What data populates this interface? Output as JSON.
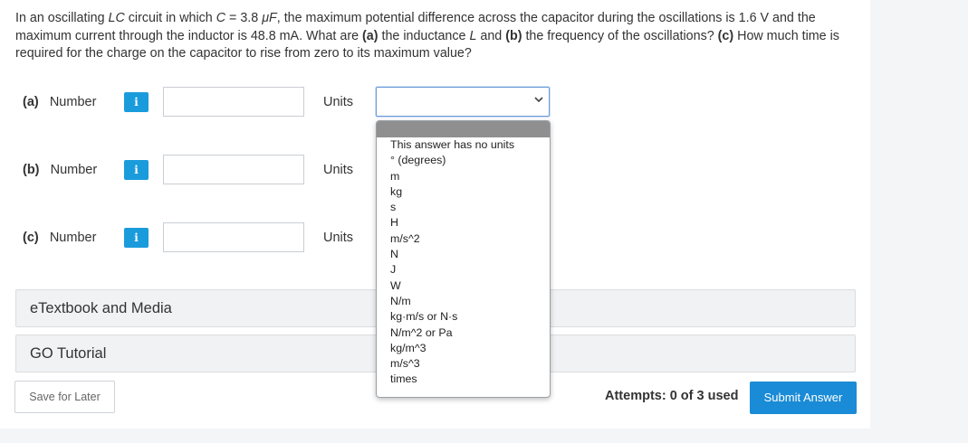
{
  "question": {
    "seg1": "In an oscillating ",
    "seg2": "LC",
    "seg3": " circuit in which ",
    "seg4": "C",
    "seg5": " = 3.8 ",
    "seg6": "μF",
    "seg7": ", the maximum potential difference across the capacitor during the oscillations is 1.6 V and the maximum current through the inductor is 48.8 mA. What are ",
    "seg8": "(a)",
    "seg9": " the inductance ",
    "seg10": "L",
    "seg11": " and ",
    "seg12": "(b)",
    "seg13": " the frequency of the oscillations? ",
    "seg14": "(c)",
    "seg15": " How much time is required for the charge on the capacitor to rise from zero to its maximum value?"
  },
  "parts": [
    {
      "id": "(a)",
      "label": "Number",
      "units_label": "Units",
      "value": ""
    },
    {
      "id": "(b)",
      "label": "Number",
      "units_label": "Units",
      "value": ""
    },
    {
      "id": "(c)",
      "label": "Number",
      "units_label": "Units",
      "value": ""
    }
  ],
  "info_icon": "i",
  "units_dropdown": {
    "selected": "",
    "options": [
      "This answer has no units",
      "° (degrees)",
      "m",
      "kg",
      "s",
      "H",
      "m/s^2",
      "N",
      "J",
      "W",
      "N/m",
      "kg·m/s or N·s",
      "N/m^2 or Pa",
      "kg/m^3",
      "m/s^3",
      "times"
    ]
  },
  "accordions": [
    "eTextbook and Media",
    "GO Tutorial"
  ],
  "footer": {
    "save_label": "Save for Later",
    "attempts": "Attempts: 0 of 3 used",
    "submit_label": "Submit Answer"
  },
  "colors": {
    "accent": "#1a8bd6",
    "info": "#1a9bdc",
    "highlight": "#8f8f8f"
  }
}
